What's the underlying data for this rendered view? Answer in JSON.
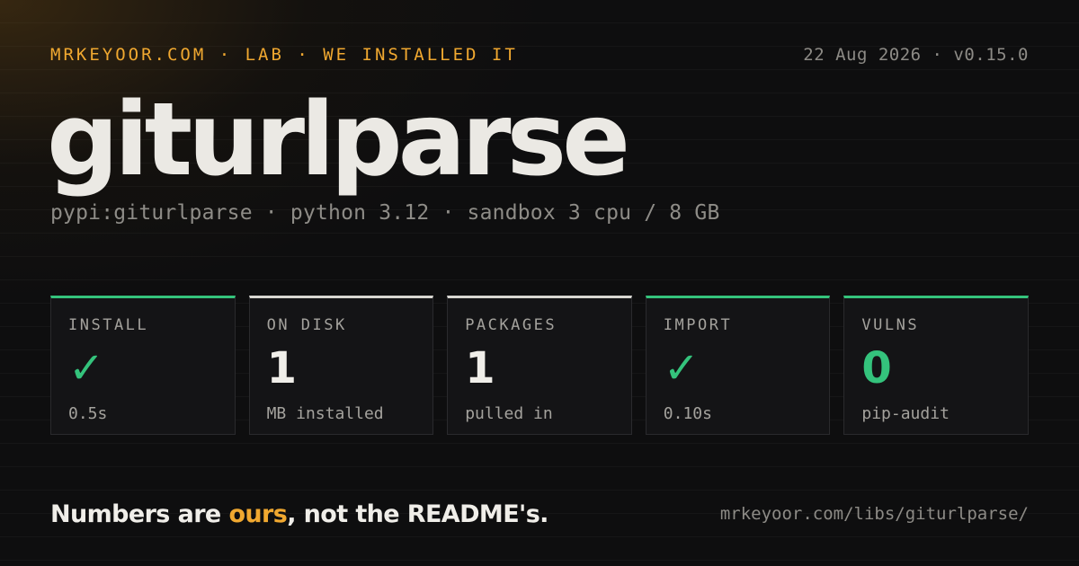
{
  "header": {
    "kicker": "MRKEYOOR.COM · LAB · WE INSTALLED IT",
    "dateline": "22 Aug 2026 · v0.15.0"
  },
  "package": {
    "name": "giturlparse",
    "meta": "pypi:giturlparse · python 3.12 · sandbox 3 cpu / 8 GB"
  },
  "stats": [
    {
      "label": "INSTALL",
      "value": "✓",
      "note": "0.5s",
      "status": "ok"
    },
    {
      "label": "ON DISK",
      "value": "1",
      "note": "MB installed",
      "status": "neutral"
    },
    {
      "label": "PACKAGES",
      "value": "1",
      "note": "pulled in",
      "status": "neutral"
    },
    {
      "label": "IMPORT",
      "value": "✓",
      "note": "0.10s",
      "status": "ok"
    },
    {
      "label": "VULNS",
      "value": "0",
      "note": "pip-audit",
      "status": "ok"
    }
  ],
  "footer": {
    "tagline_before": "Numbers are ",
    "tagline_accent": "ours",
    "tagline_after": ", not the README's.",
    "url": "mrkeyoor.com/libs/giturlparse/"
  },
  "colors": {
    "accent": "#f0a830",
    "ok": "#34c37c",
    "neutral": "#d8d6d1",
    "background": "#0e0e0f"
  }
}
